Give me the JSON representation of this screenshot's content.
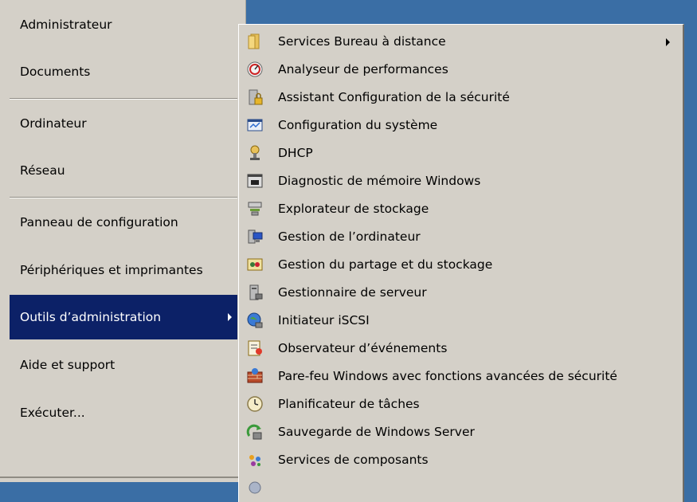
{
  "start_menu": {
    "items": [
      {
        "label": "Administrateur"
      },
      {
        "label": "Documents"
      },
      {
        "label": "Ordinateur"
      },
      {
        "label": "Réseau"
      },
      {
        "label": "Panneau de configuration"
      },
      {
        "label": "Périphériques et imprimantes"
      },
      {
        "label": "Outils d’administration"
      },
      {
        "label": "Aide et support"
      },
      {
        "label": "Exécuter..."
      }
    ],
    "selected_color": "#0c2167"
  },
  "submenu": {
    "items": [
      {
        "label": "Services Bureau à distance",
        "icon": "folder-icon"
      },
      {
        "label": "Analyseur de performances",
        "icon": "performance-monitor-icon"
      },
      {
        "label": "Assistant Configuration de la sécurité",
        "icon": "security-wizard-icon"
      },
      {
        "label": "Configuration du système",
        "icon": "system-config-icon"
      },
      {
        "label": "DHCP",
        "icon": "dhcp-icon"
      },
      {
        "label": "Diagnostic de mémoire Windows",
        "icon": "memory-diagnostic-icon"
      },
      {
        "label": "Explorateur de stockage",
        "icon": "storage-explorer-icon"
      },
      {
        "label": "Gestion de l’ordinateur",
        "icon": "computer-management-icon"
      },
      {
        "label": "Gestion du partage et du stockage",
        "icon": "share-storage-icon"
      },
      {
        "label": "Gestionnaire de serveur",
        "icon": "server-manager-icon"
      },
      {
        "label": "Initiateur iSCSI",
        "icon": "iscsi-icon"
      },
      {
        "label": "Observateur d’événements",
        "icon": "event-viewer-icon"
      },
      {
        "label": "Pare-feu Windows avec fonctions avancées de sécurité",
        "icon": "firewall-icon"
      },
      {
        "label": "Planificateur de tâches",
        "icon": "task-scheduler-icon"
      },
      {
        "label": "Sauvegarde de Windows Server",
        "icon": "backup-icon"
      },
      {
        "label": "Services de composants",
        "icon": "component-services-icon"
      }
    ]
  }
}
